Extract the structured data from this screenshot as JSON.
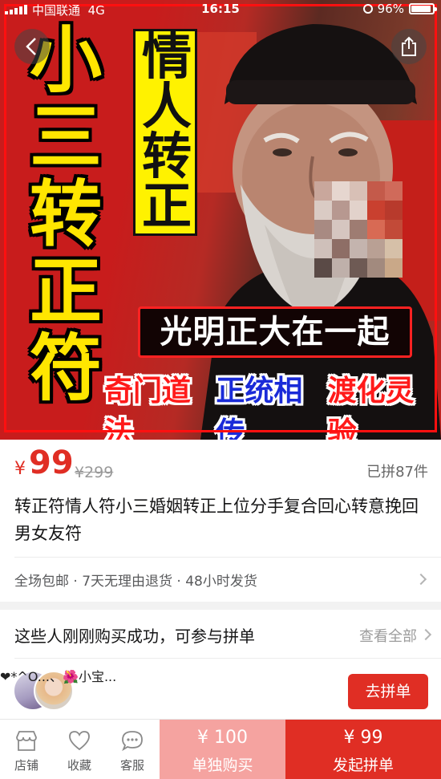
{
  "status_bar": {
    "carrier": "中国联通",
    "network": "4G",
    "time": "16:15",
    "battery": "96%"
  },
  "hero": {
    "vertical_big": [
      "小",
      "三",
      "转",
      "正",
      "符"
    ],
    "vertical_small": [
      "情",
      "人",
      "转",
      "正"
    ],
    "banner_main": "光明正大在一起",
    "banner_sub": [
      "奇门道法",
      "正统相传",
      "渡化灵验"
    ]
  },
  "icons": {
    "back": "chevron-left-icon",
    "share": "share-icon",
    "store": "store-icon",
    "favorite": "heart-icon",
    "service": "chat-bubble-icon",
    "more": "chevron-right-icon"
  },
  "product": {
    "currency": "¥",
    "price": "99",
    "original_price": "¥299",
    "sold": "已拼87件",
    "title": "转正符情人符小三婚姻转正上位分手复合回心转意挽回男女友符"
  },
  "service": {
    "text": "全场包邮 · 7天无理由退货 · 48小时发货"
  },
  "group": {
    "heading": "这些人刚刚购买成功，可参与拼单",
    "view_all": "查看全部",
    "names": "❤*^O...、🌺小宝...",
    "join_label": "去拼单"
  },
  "bottom_bar": {
    "store_label": "店铺",
    "favorite_label": "收藏",
    "service_label": "客服",
    "single_price": "¥ 100",
    "single_label": "单独购买",
    "group_price": "¥ 99",
    "group_label": "发起拼单"
  },
  "colors": {
    "accent": "#e02e24",
    "accent_light": "#f5a3a0",
    "hero_yellow": "#ffe600",
    "hero_red": "#c81c1c"
  }
}
